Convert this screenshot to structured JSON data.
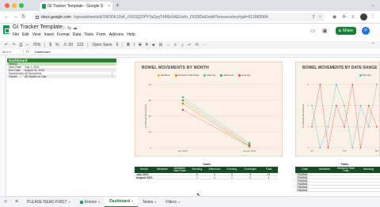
{
  "browser": {
    "tab_title": "GI Tracker Template - Google S",
    "tab_close": "×",
    "new_tab": "+",
    "url_host": "docs.google.com",
    "url_path": "/spreadsheets/d/1NODKJZsK_rDGSQOPYTaZyqT496bXAEUoKr_DGDlDsE/edit?resourcekey#gid=612883964",
    "colors": {
      "chrome": "#dee1e6",
      "traffic_red": "#ff5f57",
      "traffic_yellow": "#febc2e",
      "traffic_green": "#28c840"
    }
  },
  "sheets": {
    "doc_title": "GI Tracker Template",
    "menu": [
      "File",
      "Edit",
      "View",
      "Insert",
      "Format",
      "Data",
      "Tools",
      "Form",
      "Add-ons",
      "Help"
    ],
    "share_label": "Share",
    "user_initial": "P",
    "toolbar": {
      "zoom": "75%",
      "currency": "$",
      "percent": "%",
      "decimals": ".0 .00",
      "number_format": "123",
      "font": "Open Sans",
      "font_size": "9",
      "bold": "B",
      "italic": "I",
      "strike": "S",
      "text_color": "A"
    },
    "name_box": "A1:C1",
    "fx": "fx",
    "formula": "Dashboard",
    "colors": {
      "brand": "#0f9d58",
      "share": "#188038",
      "avatar": "#1a73e8"
    }
  },
  "dashboard": {
    "header": "Dashboard",
    "subheader": "History",
    "rows": [
      {
        "label": "Start Date",
        "value": "July 1, 2021"
      },
      {
        "label": "End Date",
        "value": "August 31, 2021"
      },
      {
        "label": "Symptom(s)",
        "value": "All Symptoms"
      },
      {
        "label": "Impact",
        "value": "All Impact on Day"
      }
    ],
    "colors": {
      "header": "#2e7d32",
      "sub": "#cbe0c3"
    }
  },
  "chart_data": [
    {
      "type": "line",
      "title": "BOWEL MOVEMENTS BY MONTH",
      "categories": [
        "July 2021",
        "August 2021"
      ],
      "ylabel": "# of Bowel Movements",
      "ylim": [
        0,
        40
      ],
      "yticks": [
        0,
        10,
        20,
        30,
        40
      ],
      "series": [
        {
          "name": "Medicine",
          "color": "#f4b400",
          "values": [
            28,
            1
          ]
        },
        {
          "name": "Medicine Start Date",
          "color": "#ff6d01",
          "values": [
            28,
            1
          ]
        },
        {
          "name": "Morning",
          "color": "#46bdc6",
          "values": [
            32,
            3
          ]
        },
        {
          "name": "Afternoon",
          "color": "#34a853",
          "values": [
            30,
            2
          ]
        },
        {
          "name": "Evening",
          "color": "#ea4335",
          "values": [
            24,
            1
          ]
        }
      ],
      "legend_position": "top",
      "grid": true
    },
    {
      "type": "line",
      "title": "BOWEL MOVEMENTS BY DATE RANGE",
      "ylabel": "# of Bowel Movements",
      "ylim": [
        0,
        3
      ],
      "yticks": [
        0,
        1,
        2,
        3
      ],
      "categories": [
        "7/1",
        "7/5",
        "7/9",
        "7/13",
        "7/17",
        "7/21",
        "7/25",
        "7/29",
        "8/2"
      ],
      "series": [
        {
          "name": "Morning",
          "color": "#46bdc6",
          "values": [
            2,
            0,
            1,
            3,
            2,
            0,
            2,
            1,
            3
          ]
        },
        {
          "name": "Evening",
          "color": "#ea4335",
          "values": [
            1,
            3,
            0,
            2,
            1,
            3,
            0,
            2,
            1
          ]
        }
      ],
      "legend_position": "top",
      "grid": true
    }
  ],
  "totals_label": "Totals",
  "totals_table": {
    "headers": [
      "Month",
      "Medicine",
      "Medicine Start Date",
      "Morning",
      "Afternoon",
      "Evening",
      "Overnight",
      "Total"
    ],
    "rows": [
      [
        "July 2021",
        "",
        "",
        "6",
        "4",
        "9",
        "5",
        "24"
      ],
      [
        "August 2021",
        "",
        "",
        "1",
        "1",
        "1",
        "1",
        "4"
      ]
    ],
    "colors": {
      "header": "#174b22"
    }
  },
  "totals_table2": {
    "headers": [
      "Date",
      "Medicine",
      "Medicine Start Date",
      "Morning"
    ],
    "rows": [
      [
        "7/1/2021"
      ],
      [
        "7/2/2021"
      ],
      [
        "7/3/2021"
      ],
      [
        "7/4/2021"
      ],
      [
        "7/5/2021"
      ],
      [
        "7/6/2021"
      ]
    ]
  },
  "sheet_tabs": {
    "add": "+",
    "all": "≡",
    "tabs": [
      {
        "label": "PLEASE READ FIRST"
      },
      {
        "label": "Entries"
      },
      {
        "label": "Dashboard"
      },
      {
        "label": "Notes"
      },
      {
        "label": "Filters"
      }
    ],
    "active": "Dashboard"
  }
}
